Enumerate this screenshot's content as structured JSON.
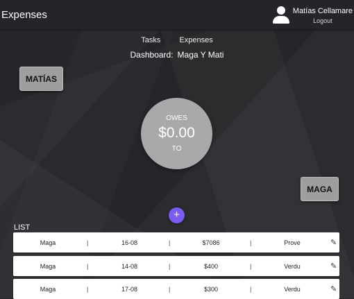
{
  "header": {
    "title": "Expenses",
    "user_name": "Matías Cellamare",
    "logout_label": "Logout"
  },
  "nav": {
    "items": [
      "Tasks",
      "Expenses"
    ]
  },
  "dashboard": {
    "label": "Dashboard:",
    "group": "Maga Y Mati"
  },
  "people": {
    "left": "MATÍAS",
    "right": "MAGA"
  },
  "balance": {
    "owes_label": "OWES",
    "amount": "$0.00",
    "to_label": "TO"
  },
  "add_button_label": "+",
  "list": {
    "label": "LIST",
    "separator": "|",
    "rows": [
      {
        "name": "Maga",
        "date": "16-08",
        "amount": "$7086",
        "category": "Prove"
      },
      {
        "name": "Maga",
        "date": "14-08",
        "amount": "$400",
        "category": "Verdu"
      },
      {
        "name": "Maga",
        "date": "17-08",
        "amount": "$300",
        "category": "Verdu"
      }
    ]
  },
  "icons": {
    "user": "user-icon",
    "edit": "pencil-icon",
    "add": "plus-icon"
  },
  "colors": {
    "add_button": "#7b5cf0",
    "person_box": "#9e9e9e",
    "balance_circle": "#a9a9ab"
  }
}
